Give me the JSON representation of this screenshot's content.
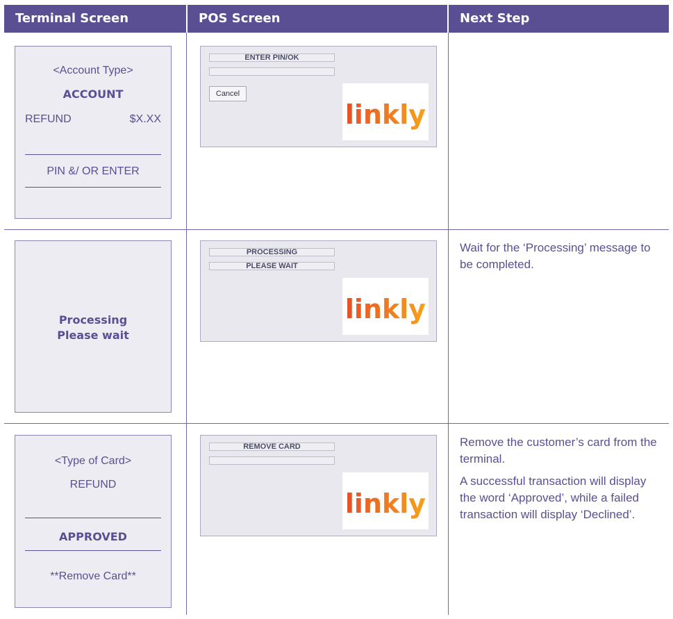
{
  "headers": [
    "Terminal Screen",
    "POS Screen",
    "Next Step"
  ],
  "rows": [
    {
      "terminal": {
        "line1": "<Account Type>",
        "line2": "ACCOUNT",
        "refund_label": "REFUND",
        "amount": "$X.XX",
        "line4": "PIN &/ OR ENTER"
      },
      "pos": {
        "field1": "ENTER PIN/OK",
        "field2": "",
        "cancel_label": "Cancel",
        "logo_text": "linkly"
      },
      "next_step": []
    },
    {
      "terminal": {
        "line1": "Processing",
        "line2": "Please wait"
      },
      "pos": {
        "field1": "PROCESSING",
        "field2": "PLEASE WAIT",
        "logo_text": "linkly"
      },
      "next_step": [
        "Wait for the ‘Processing’ message to be completed."
      ]
    },
    {
      "terminal": {
        "line1": "<Type of Card>",
        "line2": "REFUND",
        "line3": "APPROVED",
        "line4": "**Remove Card**"
      },
      "pos": {
        "field1": "REMOVE CARD",
        "field2": "",
        "logo_text": "linkly"
      },
      "next_step": [
        "Remove the customer’s card from the terminal.",
        "A successful transaction will display the word ‘Approved’, while a failed transaction will display ‘Declined’."
      ]
    }
  ],
  "colors": {
    "brand": "#5b4f93",
    "panel": "#edecf2",
    "logo_orange": "#f07b2c"
  }
}
